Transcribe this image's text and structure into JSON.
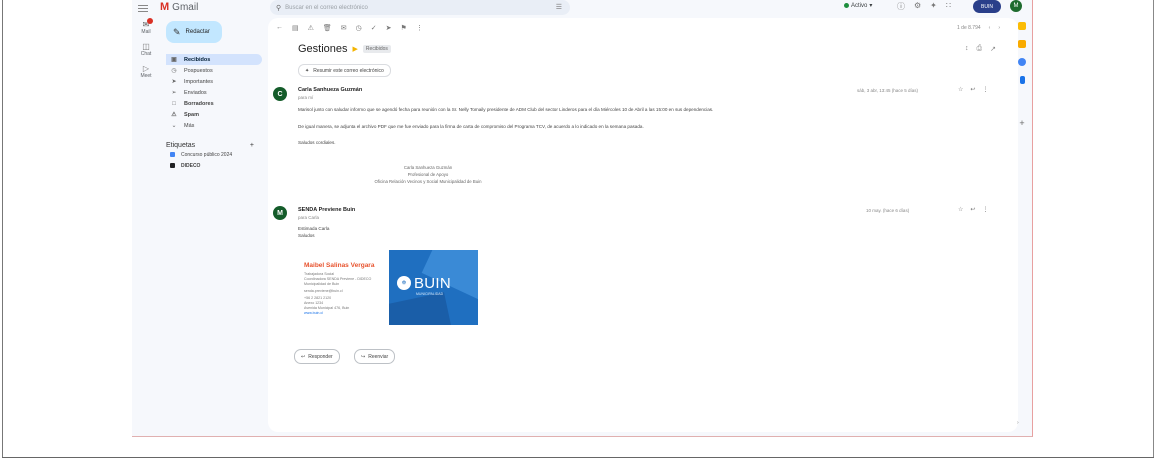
{
  "app": {
    "name": "Gmail",
    "search_placeholder": "Buscar en el correo electrónico",
    "status": "Activo",
    "brand_chip": "BUIN",
    "account_initial": "M"
  },
  "rail": [
    {
      "label": "Mail"
    },
    {
      "label": "Chat"
    },
    {
      "label": "Meet"
    }
  ],
  "nav": {
    "compose": "Redactar",
    "items": [
      {
        "label": "Recibidos",
        "count": ""
      },
      {
        "label": "Pospuestos",
        "count": ""
      },
      {
        "label": "Importantes",
        "count": ""
      },
      {
        "label": "Enviados",
        "count": ""
      },
      {
        "label": "Borradores",
        "count": ""
      },
      {
        "label": "Spam",
        "count": ""
      },
      {
        "label": "Más",
        "count": ""
      }
    ],
    "labels_title": "Etiquetas",
    "labels": [
      {
        "label": "Concurso público 2024",
        "color": "#4285f4",
        "count": ""
      },
      {
        "label": "DIDECO",
        "color": "#202124",
        "count": ""
      }
    ]
  },
  "thread": {
    "subject": "Gestiones",
    "subject_tag": "Recibidos",
    "summarize": "Resumir este correo electrónico",
    "pager": "1 de 8.794",
    "messages": [
      {
        "avatar": "C",
        "sender": "Carla Sanhueza Guzmán",
        "recipient": "para mí",
        "date": "sáb, 3 abr, 13:45 (hace 5 días)",
        "lines": [
          "Marisol junto con saludar informo que se agendó fecha para reunión con la Sr. Nelly Tomaily presidente de ADM Club del sector Linderos para el día Miércoles 10 de Abril a las 15:00 en sus dependencias.",
          "De igual manera, se adjunta el archivo PDF que me fue enviado para la firma de carta de compromiso del Programa TCV, de acuerdo a lo indicado en la semana pasada.",
          "Saludos cordiales."
        ],
        "signature": [
          "Carla Sanhueza Guzmán",
          "Profesional de Apoyo",
          "Oficina Relación Vecinos y Social Municipalidad de Buin"
        ]
      },
      {
        "avatar": "M",
        "sender": "SENDA Previene Buin",
        "recipient": "para Carla",
        "date": "10 may. (hace 6 días)",
        "lines": [
          "Estimada Carla",
          "Saludos"
        ],
        "card": {
          "name": "Maibel Salinas Vergara",
          "lines": [
            "Trabajadora Social",
            "Coordinadora SENDA Previene - DIDECO",
            "Municipalidad de Buin",
            "senda.previene@buin.cl",
            "+56 2 2821 2120",
            "Anexo 1234",
            "Avenida Municipal 476, Buin",
            "www.buin.cl"
          ],
          "logo_text": "BUIN",
          "logo_sub": "MUNICIPALIDAD"
        }
      }
    ],
    "reply": "Responder",
    "forward": "Reenviar"
  }
}
